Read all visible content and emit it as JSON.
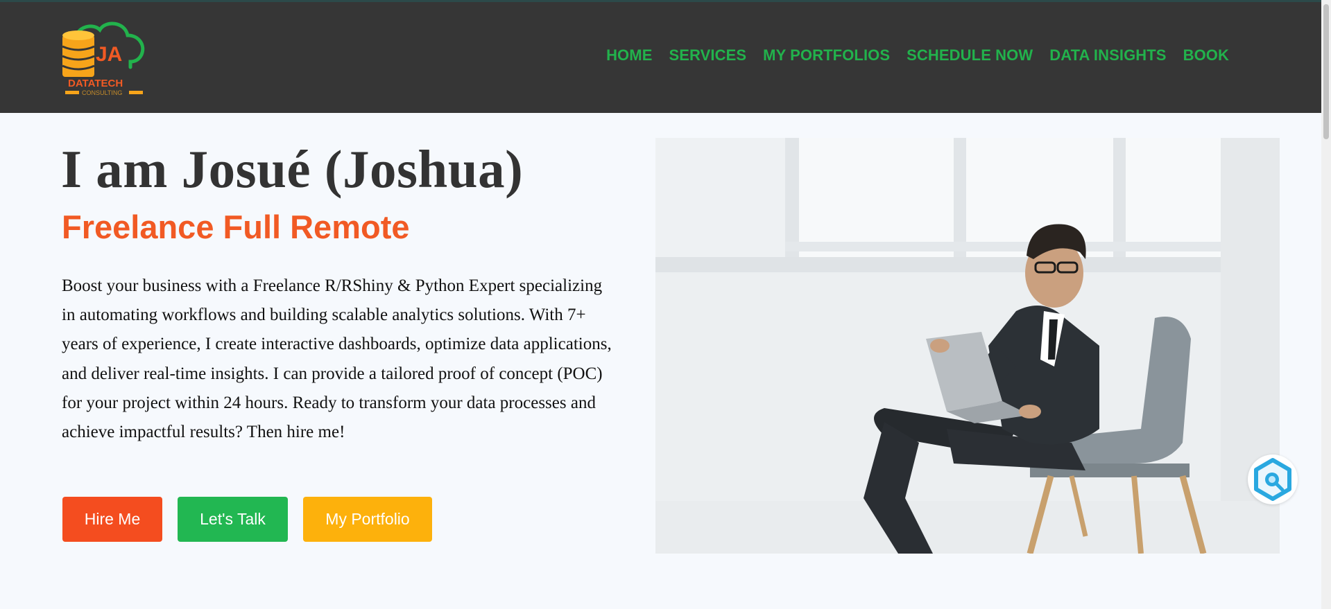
{
  "logo": {
    "initials": "JA",
    "brand": "DATATECH",
    "tagline": "CONSULTING"
  },
  "nav": {
    "items": [
      {
        "label": "HOME"
      },
      {
        "label": "SERVICES"
      },
      {
        "label": "MY PORTFOLIOS"
      },
      {
        "label": "SCHEDULE NOW"
      },
      {
        "label": "DATA INSIGHTS"
      },
      {
        "label": "BOOK"
      }
    ]
  },
  "hero": {
    "title": "I am Josué (Joshua)",
    "subtitle": "Freelance Full Remote",
    "body": "Boost your business with a Freelance R/RShiny & Python Expert specializing in automating workflows and building scalable analytics solutions. With 7+ years of experience, I create interactive dashboards, optimize data applications, and deliver real-time insights. I can provide a tailored proof of concept (POC) for your project within 24 hours. Ready to transform your data processes and achieve impactful results? Then hire me!",
    "buttons": {
      "hire": "Hire Me",
      "talk": "Let's Talk",
      "portfolio": "My Portfolio"
    }
  },
  "colors": {
    "navbar_bg": "#363636",
    "nav_link": "#22b24c",
    "accent_orange": "#f15a24",
    "btn_hire": "#f44d1f",
    "btn_talk": "#22b752",
    "btn_portfolio": "#fdb10c",
    "page_bg": "#f6f9fd"
  },
  "icons": {
    "search_widget": "magnifier-icon"
  }
}
